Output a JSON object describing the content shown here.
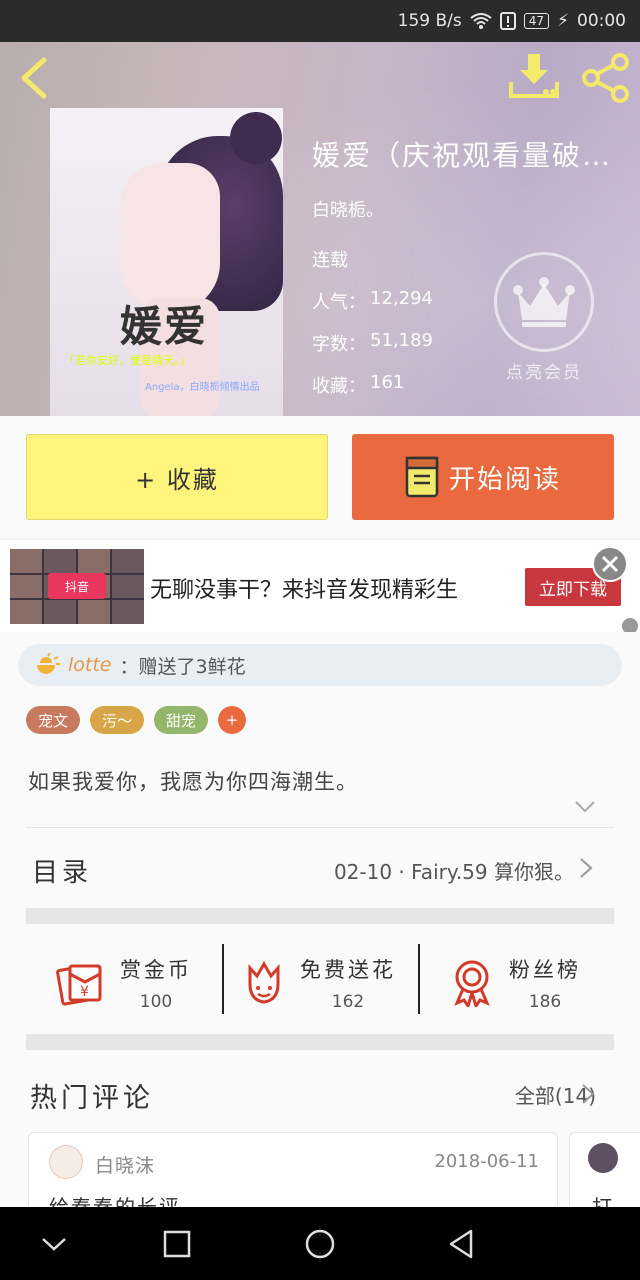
{
  "status_bar": {
    "speed": "159 B/s",
    "battery": "47",
    "time": "00:00"
  },
  "header": {
    "book_title": "媛爱（庆祝观看量破…",
    "author": "白晓栀。",
    "status": "连载",
    "popularity_label": "人气：",
    "popularity": "12,294",
    "words_label": "字数：",
    "words": "51,189",
    "favorites_label": "收藏：",
    "favorites": "161",
    "vip_label": "点亮会员",
    "cover": {
      "title": "媛爱",
      "subtitle": "「若你安好，便是晴天。」",
      "author": "Angela，白晓栀倾情出品"
    },
    "accent_color": "#f3e96b"
  },
  "actions": {
    "collect_label": "+ 收藏",
    "read_label": "开始阅读"
  },
  "ad": {
    "text": "无聊没事干？来抖音发现精彩生",
    "cta": "立即下载",
    "brand": "抖音"
  },
  "gift": {
    "user": "lotte",
    "message": "：赠送了3鲜花"
  },
  "tags": [
    "宠文",
    "污～",
    "甜宠",
    "+"
  ],
  "intro": "如果我爱你，我愿为你四海潮生。",
  "toc": {
    "label": "目录",
    "latest": "02-10 · Fairy.59 算你狠。"
  },
  "stats": [
    {
      "label": "赏金币",
      "value": "100",
      "icon": "red-envelope-icon"
    },
    {
      "label": "免费送花",
      "value": "162",
      "icon": "flower-icon"
    },
    {
      "label": "粉丝榜",
      "value": "186",
      "icon": "medal-icon"
    }
  ],
  "hot_comments": {
    "title": "热门评论",
    "all_label": "全部(14)",
    "items": [
      {
        "user": "白晓沫",
        "date": "2018-06-11",
        "text": "给秦秦的长评"
      },
      {
        "text": "打"
      }
    ]
  }
}
